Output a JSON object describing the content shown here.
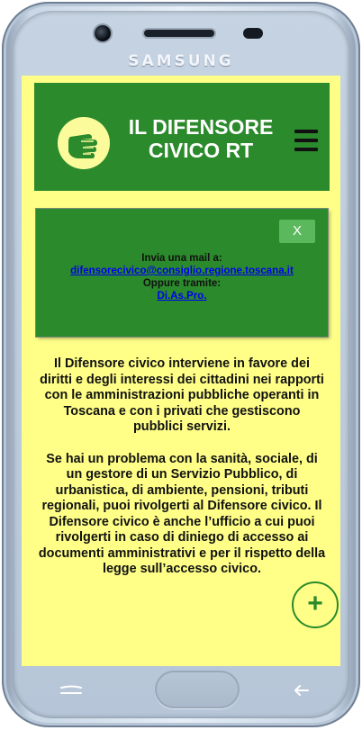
{
  "device": {
    "brand": "SAMSUNG"
  },
  "header": {
    "title": "IL DIFENSORE\nCIVICO RT",
    "logo_icon": "hand-icon",
    "menu_icon": "hamburger-menu-icon"
  },
  "notice": {
    "close_label": "X",
    "line1": "Invia una mail a:",
    "email": "difensorecivico@consiglio.regione.toscana.it",
    "line2": "Oppure tramite:",
    "link2": "Di.As.Pro."
  },
  "body": {
    "paragraph1": "Il Difensore civico interviene in favore dei diritti e degli interessi dei cittadini nei rapporti con le amministrazioni pubbliche operanti in Toscana e con i privati che gestiscono pubblici servizi.",
    "paragraph2": "Se hai un problema con la sanità, sociale, di un gestore di un Servizio Pubblico, di urbanistica, di ambiente, pensioni, tributi regionali, puoi rivolgerti al Difensore civico. Il Difensore civico è anche l’ufficio a cui puoi rivolgerti in caso di diniego di accesso ai documenti amministrativi e per il rispetto della legge sull’accesso civico."
  },
  "fab": {
    "label": "+"
  },
  "colors": {
    "screen_background": "#ffff88",
    "header_green": "#2b8a2b",
    "close_button_green": "#5cb85c",
    "link_blue": "#0000ee"
  }
}
